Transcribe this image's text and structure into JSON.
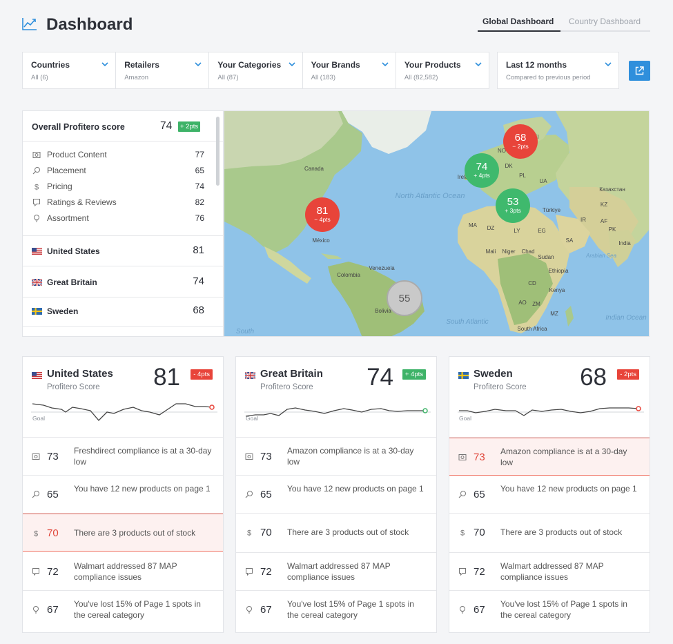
{
  "header": {
    "title": "Dashboard",
    "tabs": [
      {
        "label": "Global Dashboard"
      },
      {
        "label": "Country Dashboard"
      }
    ]
  },
  "filters": [
    {
      "label": "Countries",
      "value": "All (6)"
    },
    {
      "label": "Retailers",
      "value": "Amazon"
    },
    {
      "label": "Your Categories",
      "value": "All (87)"
    },
    {
      "label": "Your Brands",
      "value": "All (183)"
    },
    {
      "label": "Your Products",
      "value": "All (82,582)"
    }
  ],
  "period": {
    "label": "Last 12 months",
    "sub": "Compared to previous period"
  },
  "score_panel": {
    "title": "Overall Profitero score",
    "score": "74",
    "delta": "+ 2pts",
    "categories": [
      {
        "label": "Product Content",
        "value": "77",
        "icon": "camera-icon"
      },
      {
        "label": "Placement",
        "value": "65",
        "icon": "search-icon"
      },
      {
        "label": "Pricing",
        "value": "74",
        "icon": "dollar-icon"
      },
      {
        "label": "Ratings & Reviews",
        "value": "82",
        "icon": "comment-icon"
      },
      {
        "label": "Assortment",
        "value": "76",
        "icon": "lightbulb-icon"
      }
    ],
    "countries": [
      {
        "name": "United States",
        "value": "81"
      },
      {
        "name": "Great Britain",
        "value": "74"
      },
      {
        "name": "Sweden",
        "value": "68"
      }
    ]
  },
  "map": {
    "labels": [
      "North Atlantic Ocean",
      "South Atlantic",
      "Indian Ocean",
      "South",
      "Canada",
      "México",
      "Venezuela",
      "Colombia",
      "Bolivia",
      "Mali",
      "Niger",
      "Chad",
      "Sudan",
      "Ethiopia",
      "Kenya",
      "India",
      "Arabian Sea",
      "Türkiye",
      "Казахстан",
      "MA",
      "DZ",
      "LY",
      "EG",
      "SA",
      "IR",
      "AF",
      "PK",
      "AO",
      "CD",
      "ZM",
      "MZ",
      "South Africa",
      "Ireland",
      "UK",
      "NO",
      "FI",
      "DK",
      "PL",
      "UA",
      "KZ"
    ],
    "bubbles": [
      {
        "value": "81",
        "delta": "− 4pts",
        "color": "#e8443a"
      },
      {
        "value": "74",
        "delta": "+ 4pts",
        "color": "#3fb96d"
      },
      {
        "value": "68",
        "delta": "− 2pts",
        "color": "#e8443a"
      },
      {
        "value": "53",
        "delta": "+ 3pts",
        "color": "#3fb96d"
      },
      {
        "value": "55",
        "delta": "",
        "color": "#c9c9c9"
      }
    ]
  },
  "cards": [
    {
      "country": "United States",
      "sub": "Profitero Score",
      "score": "81",
      "delta": "- 4pts",
      "delta_color": "#e8443a",
      "goal": "Goal",
      "rows": [
        {
          "num": "73",
          "text": "Freshdirect compliance is at a 30-day low",
          "icon": "camera-icon",
          "alert": false
        },
        {
          "num": "65",
          "text": "You have 12 new products on page 1",
          "icon": "search-icon",
          "alert": false
        },
        {
          "num": "70",
          "text": "There are 3 products out of stock",
          "icon": "dollar-icon",
          "alert": true
        },
        {
          "num": "72",
          "text": "Walmart addressed 87 MAP compliance issues",
          "icon": "comment-icon",
          "alert": false
        },
        {
          "num": "67",
          "text": "You've lost 15% of Page 1 spots in the cereal category",
          "icon": "lightbulb-icon",
          "alert": false
        }
      ]
    },
    {
      "country": "Great Britain",
      "sub": "Profitero Score",
      "score": "74",
      "delta": "+ 4pts",
      "delta_color": "#3eb368",
      "goal": "Goal",
      "rows": [
        {
          "num": "73",
          "text": "Amazon compliance is at a 30-day low",
          "icon": "camera-icon",
          "alert": false
        },
        {
          "num": "65",
          "text": "You have 12 new products on page 1",
          "icon": "search-icon",
          "alert": false
        },
        {
          "num": "70",
          "text": "There are 3 products out of stock",
          "icon": "dollar-icon",
          "alert": false
        },
        {
          "num": "72",
          "text": "Walmart addressed 87 MAP compliance issues",
          "icon": "comment-icon",
          "alert": false
        },
        {
          "num": "67",
          "text": "You've lost 15% of Page 1 spots in the cereal category",
          "icon": "lightbulb-icon",
          "alert": false
        }
      ]
    },
    {
      "country": "Sweden",
      "sub": "Profitero Score",
      "score": "68",
      "delta": "- 2pts",
      "delta_color": "#e8443a",
      "goal": "Goal",
      "rows": [
        {
          "num": "73",
          "text": "Amazon compliance is at a 30-day low",
          "icon": "camera-icon",
          "alert": true
        },
        {
          "num": "65",
          "text": "You have 12 new products on page 1",
          "icon": "search-icon",
          "alert": false
        },
        {
          "num": "70",
          "text": "There are 3 products out of stock",
          "icon": "dollar-icon",
          "alert": false
        },
        {
          "num": "72",
          "text": "Walmart addressed 87 MAP compliance issues",
          "icon": "comment-icon",
          "alert": false
        },
        {
          "num": "67",
          "text": "You've lost 15% of Page 1 spots in the cereal category",
          "icon": "lightbulb-icon",
          "alert": false
        }
      ]
    }
  ],
  "colors": {
    "accent": "#2f8fdc",
    "positive": "#3eb368",
    "negative": "#e8443a",
    "neutral": "#c9c9c9"
  }
}
